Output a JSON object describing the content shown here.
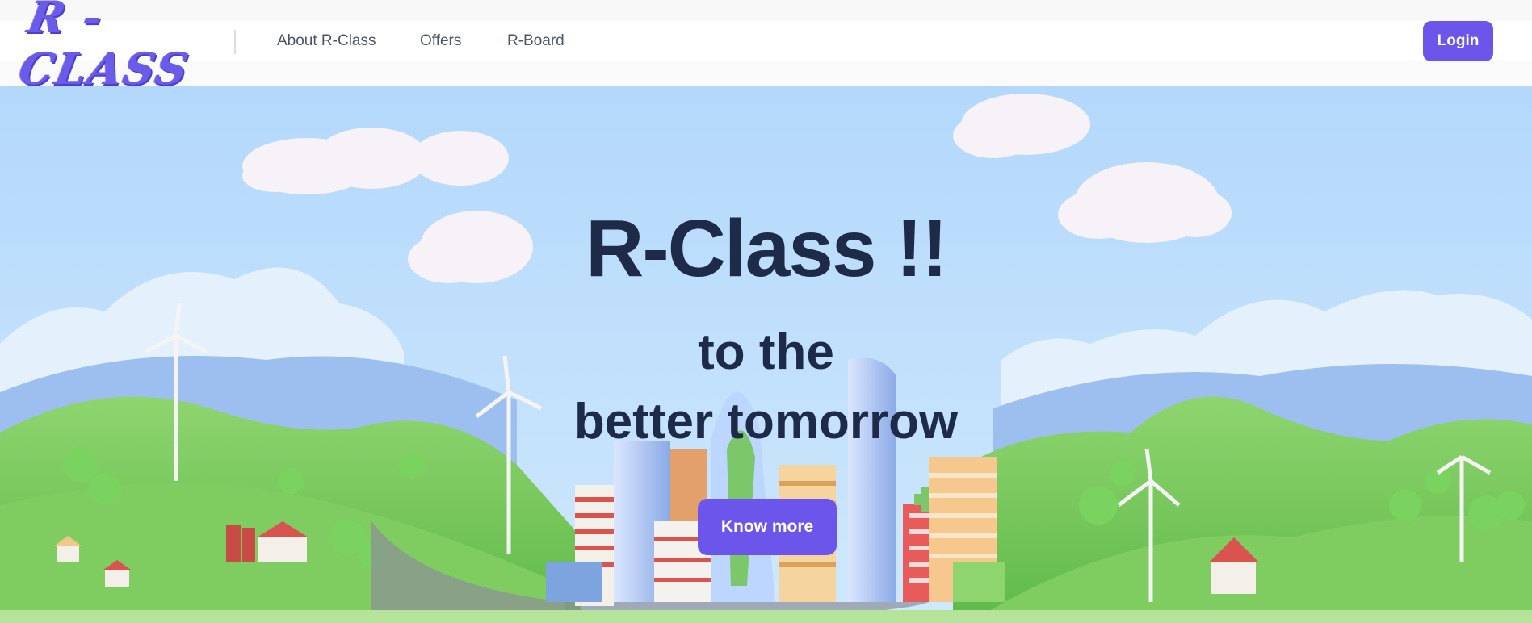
{
  "brand": {
    "logo_text": "R - CLASS",
    "accent": "#6c55ea",
    "text_dark": "#1d2b48"
  },
  "nav": {
    "links": [
      {
        "label": "About R-Class"
      },
      {
        "label": "Offers"
      },
      {
        "label": "R-Board"
      }
    ],
    "login_label": "Login"
  },
  "hero": {
    "title": "R-Class !!",
    "subtitle_line1": "to the",
    "subtitle_line2": "better tomorrow",
    "cta_label": "Know more",
    "illustration": "city-landscape-illustration",
    "sky_color": "#b9dcfb"
  }
}
